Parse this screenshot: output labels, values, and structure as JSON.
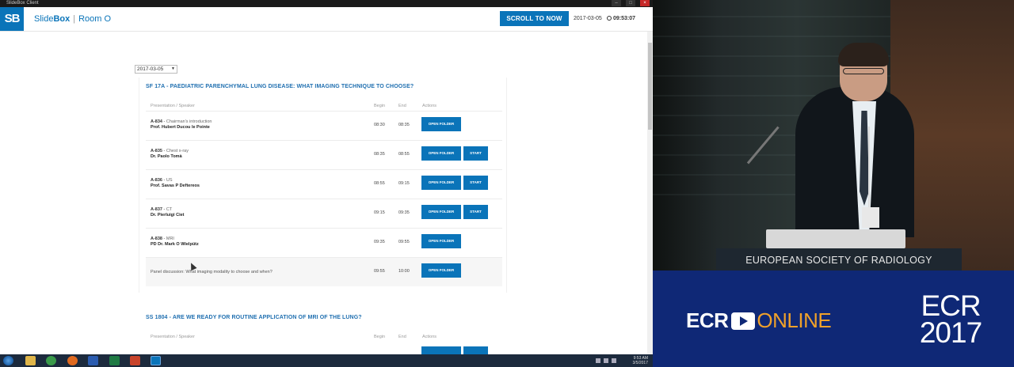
{
  "window": {
    "title": "SlideBox Client"
  },
  "header": {
    "logo": "SB",
    "brand_prefix": "Slide",
    "brand_bold": "Box",
    "separator": "|",
    "room": "Room O",
    "scroll_button": "SCROLL TO NOW",
    "date": "2017-03-05",
    "clock": "09:53:07"
  },
  "date_select": {
    "value": "2017-03-05"
  },
  "sessions": [
    {
      "title": "SF 17A - PAEDIATRIC PARENCHYMAL LUNG DISEASE: WHAT IMAGING TECHNIQUE TO CHOOSE?",
      "columns": {
        "presentation": "Presentation / Speaker",
        "begin": "Begin",
        "end": "End",
        "actions": "Actions"
      },
      "rows": [
        {
          "code": "A-834",
          "topic": "Chairman's introduction",
          "speaker": "Prof. Hubert Ducou le Pointe",
          "begin": "08:30",
          "end": "08:35",
          "open": "OPEN FOLDER",
          "start": ""
        },
        {
          "code": "A-835",
          "topic": "Chest x-ray",
          "speaker": "Dr. Paolo Tomà",
          "begin": "08:35",
          "end": "08:55",
          "open": "OPEN FOLDER",
          "start": "START"
        },
        {
          "code": "A-836",
          "topic": "US",
          "speaker": "Prof. Savas P Deftereos",
          "begin": "08:55",
          "end": "09:15",
          "open": "OPEN FOLDER",
          "start": "START"
        },
        {
          "code": "A-837",
          "topic": "CT",
          "speaker": "Dr. Pierluigi Ciet",
          "begin": "09:15",
          "end": "09:35",
          "open": "OPEN FOLDER",
          "start": "START"
        },
        {
          "code": "A-838",
          "topic": "MRI",
          "speaker": "PD Dr. Mark O Wielpütz",
          "begin": "09:35",
          "end": "09:55",
          "open": "OPEN FOLDER",
          "start": ""
        },
        {
          "code": "",
          "topic": "Panel discussion: What imaging modality to choose and when?",
          "speaker": "",
          "begin": "09:55",
          "end": "10:00",
          "open": "OPEN FOLDER",
          "start": ""
        }
      ]
    },
    {
      "title": "SS 1804 - ARE WE READY FOR ROUTINE APPLICATION OF MRI OF THE LUNG?",
      "columns": {
        "presentation": "Presentation / Speaker",
        "begin": "Begin",
        "end": "End",
        "actions": "Actions"
      }
    }
  ],
  "taskbar": {
    "time": "9:53 AM",
    "date": "3/5/2017"
  },
  "video": {
    "podium_text": "EUROPEAN SOCIETY OF RADIOLOGY",
    "banner_left_a": "ECR",
    "banner_left_b": "ONLINE",
    "banner_right_a": "ECR",
    "banner_right_b": "2017"
  },
  "colors": {
    "accent": "#0a74b9",
    "banner": "#0f2876",
    "online_orange": "#f0a12a"
  }
}
